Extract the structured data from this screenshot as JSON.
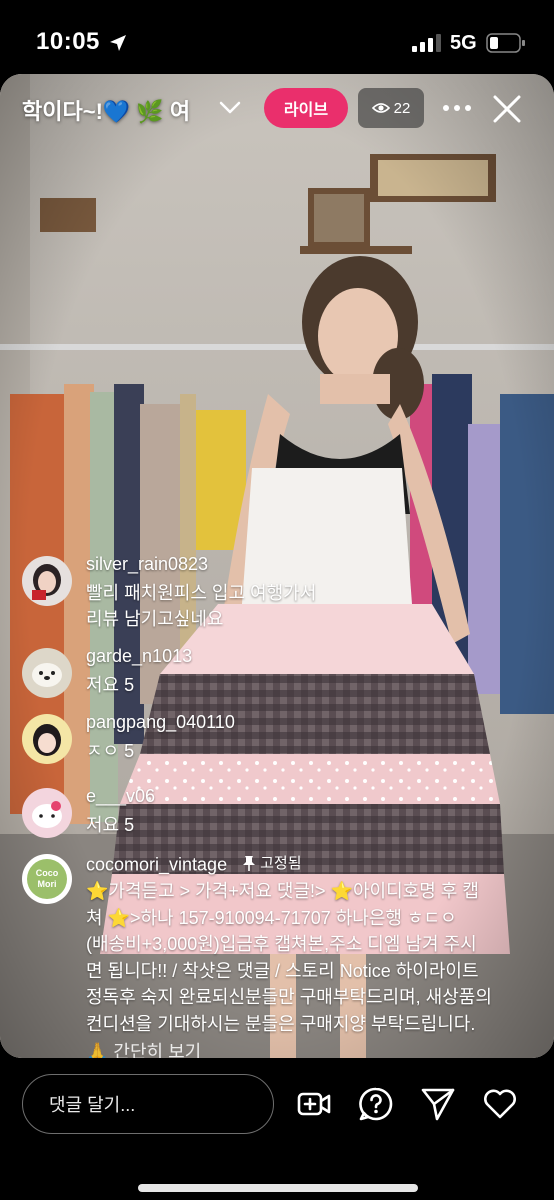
{
  "status": {
    "time": "10:05",
    "network": "5G"
  },
  "header": {
    "title": "학이다~!💙 🌿 여",
    "live_label": "라이브",
    "viewer_count": "22"
  },
  "comments": [
    {
      "username": "silver_rain0823",
      "text_lines": [
        "빨리 패치원피스 입고 여행가서",
        "리뷰 남기고싶네요"
      ]
    },
    {
      "username": "garde_n1013",
      "text_lines": [
        "저요 5"
      ]
    },
    {
      "username": "pangpang_040110",
      "text_lines": [
        "ㅈㅇ 5"
      ]
    },
    {
      "username": "e___v06",
      "text_lines": [
        "저요 5"
      ]
    }
  ],
  "pinned_comment": {
    "username": "cocomori_vintage",
    "pinned_label": "고정됨",
    "avatar_text": [
      "Coco",
      "Mori"
    ],
    "lines": [
      "⭐가격듣고 > 가격+저요 댓글!> ⭐아이디호명 후 캡",
      "쳐 ⭐>하나 157-910094-71707 하나은행 ㅎㄷㅇ",
      "(배송비+3,000원)입금후 캡쳐본,주소 디엠 남겨 주시",
      "면 됩니다!! / 착샷은 댓글 / 스토리 Notice 하이라이트",
      "정독후 숙지 완료되신분들만 구매부탁드리며, 새상품의",
      "컨디션을 기대하시는 분들은 구매지양 부탁드립니다."
    ],
    "collapse_label": "🙏 간단히 보기"
  },
  "composer": {
    "placeholder": "댓글 달기..."
  },
  "colors": {
    "live_badge": "#ea2f6c",
    "background": "#000000"
  },
  "icons": [
    "location-arrow-icon",
    "signal-icon",
    "battery-icon",
    "chevron-down-icon",
    "eye-icon",
    "more-icon",
    "close-icon",
    "pin-icon",
    "add-video-icon",
    "question-icon",
    "send-icon",
    "heart-icon"
  ]
}
